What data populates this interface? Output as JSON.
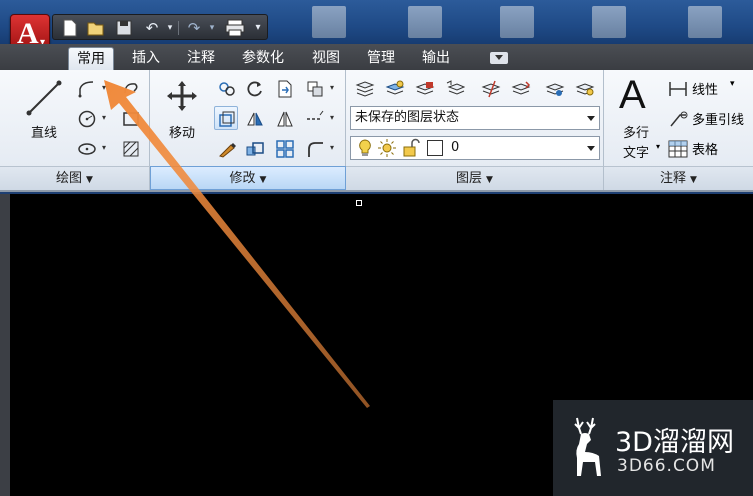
{
  "qat": {
    "icons": [
      "new-icon",
      "open-icon",
      "save-icon",
      "undo-icon",
      "redo-icon",
      "plot-icon"
    ]
  },
  "tabs": [
    {
      "label": "常用",
      "active": true
    },
    {
      "label": "插入"
    },
    {
      "label": "注释"
    },
    {
      "label": "参数化"
    },
    {
      "label": "视图"
    },
    {
      "label": "管理"
    },
    {
      "label": "输出"
    }
  ],
  "panels": {
    "draw": {
      "title": "绘图",
      "line_label": "直线"
    },
    "modify": {
      "title": "修改",
      "move_label": "移动"
    },
    "layers": {
      "title": "图层",
      "layer_state": "未保存的图层状态",
      "current_layer": "0"
    },
    "annotation": {
      "title": "注释",
      "mtext_label_1": "多行",
      "mtext_label_2": "文字",
      "linear_label": "线性",
      "mleader_label": "多重引线",
      "table_label": "表格"
    }
  },
  "watermark": {
    "main": "3D溜溜网",
    "sub": "3D66.COM"
  },
  "colors": {
    "arrow": "#f08a3c",
    "accent": "#6fa0d6"
  }
}
